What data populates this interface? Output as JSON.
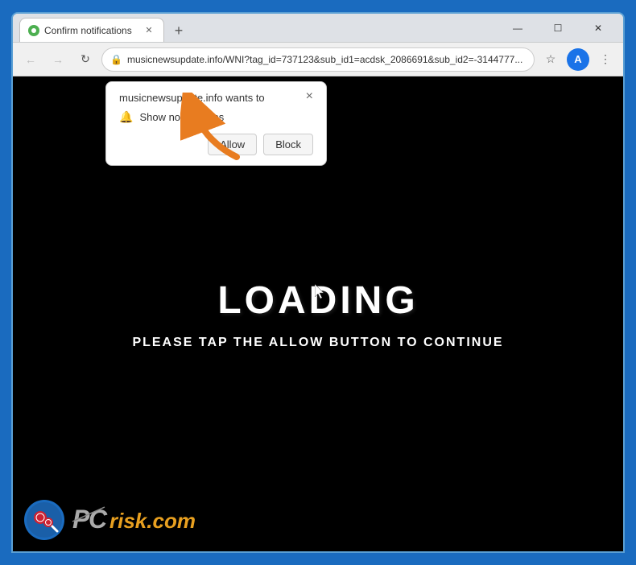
{
  "window": {
    "title": "Confirm notifications",
    "controls": {
      "minimize": "—",
      "maximize": "☐",
      "close": "✕"
    }
  },
  "tab": {
    "title": "Confirm notifications",
    "favicon_color": "#4caf50"
  },
  "new_tab_button": "+",
  "nav": {
    "back": "←",
    "forward": "→",
    "refresh": "↻",
    "address": "musicnewsupdate.info/WNI?tag_id=737123&sub_id1=acdsk_2086691&sub_id2=-3144777...",
    "domain": "musicnewsupdate.info",
    "star": "☆",
    "menu": "⋮"
  },
  "popup": {
    "site_name": "musicnewsupdate.info wants to",
    "notification_label": "Show notifications",
    "allow_button": "Allow",
    "block_button": "Block",
    "close_icon": "×"
  },
  "page": {
    "loading_text": "LOADING",
    "subtitle": "PLEASE TAP THE ALLOW BUTTON TO CONTINUE"
  },
  "logo": {
    "prefix": "PC",
    "suffix": "risk.com"
  }
}
